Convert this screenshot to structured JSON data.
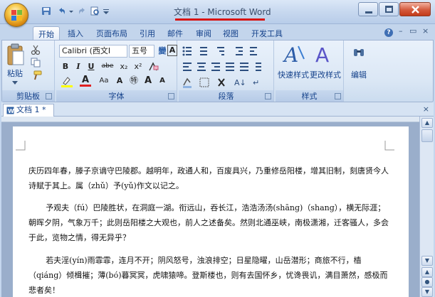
{
  "window": {
    "title": "文档 1 - Microsoft Word"
  },
  "ribbon_tabs": [
    {
      "label": "开始",
      "active": true
    },
    {
      "label": "插入"
    },
    {
      "label": "页面布局"
    },
    {
      "label": "引用"
    },
    {
      "label": "邮件"
    },
    {
      "label": "审阅"
    },
    {
      "label": "视图"
    },
    {
      "label": "开发工具"
    }
  ],
  "clipboard": {
    "paste_label": "粘贴",
    "group_label": "剪贴板"
  },
  "font": {
    "font_name": "Calibri (西文I",
    "font_size": "五号",
    "phonetic_glyph": "變",
    "border_glyph": "A",
    "bold": "B",
    "italic": "I",
    "underline": "U",
    "strike": "abe",
    "subscript": "x₂",
    "superscript": "x²",
    "clear_format": "Aa",
    "font_color": "A",
    "change_case": "Aa",
    "enclose": "㊕",
    "grow": "A",
    "shrink": "A",
    "group_label": "字体"
  },
  "paragraph": {
    "group_label": "段落"
  },
  "styles": {
    "quick_styles_label": "快速样式",
    "change_styles_label": "更改样式",
    "group_label": "样式"
  },
  "editing": {
    "label": "编辑"
  },
  "document": {
    "tab_label": "文档 1 *",
    "paragraphs": [
      "庆历四年春，滕子京谪守巴陵郡。越明年，政通人和，百废具兴，乃重修岳阳楼，增其旧制，刻唐贤今人诗赋于其上。属（zhǔ）予(yǔ)作文以记之。",
      "予观夫（fú）巴陵胜状，在洞庭一湖。衔远山，吞长江，浩浩汤汤(shāng)（shang），横无际涯；朝晖夕阴，气象万千；此则岳阳楼之大观也，前人之述备矣。然则北通巫峡，南极潇湘，迁客骚人，多会于此，览物之情，得无异乎？",
      "若夫淫(yín)雨霏霏，连月不开；阴风怒号，浊浪排空；日星隐曜，山岳潜形；商旅不行，樯（qiáng）倾楫摧；薄(bó)暮冥冥，虎啸猿啼。登斯楼也，则有去国怀乡，忧谗畏讥，满目萧然，感极而悲者矣！"
    ]
  },
  "colors": {
    "title_underline": "#d9140f",
    "ribbon_text": "#15428b"
  }
}
